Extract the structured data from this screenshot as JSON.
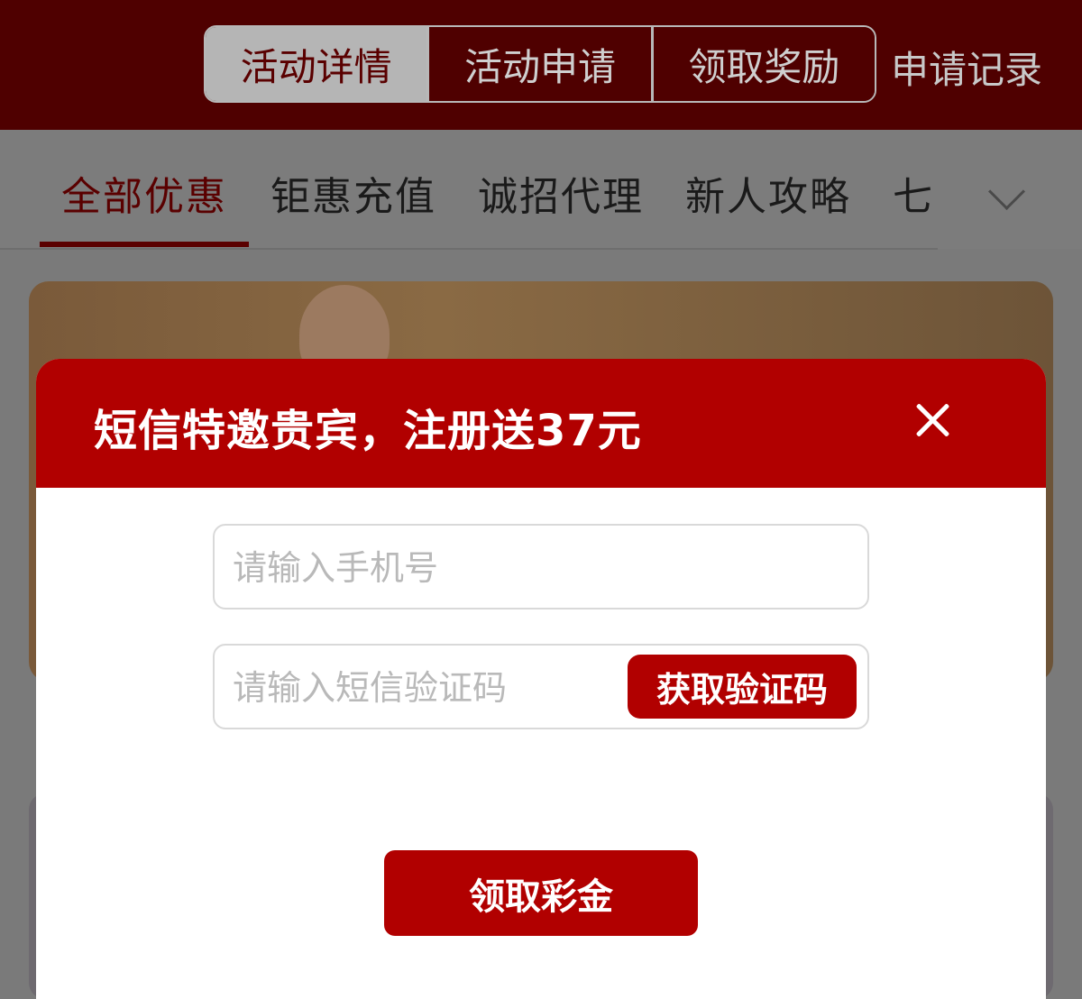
{
  "header": {
    "tabs": [
      {
        "label": "活动详情",
        "active": true
      },
      {
        "label": "活动申请",
        "active": false
      },
      {
        "label": "领取奖励",
        "active": false
      }
    ],
    "record_label": "申请记录"
  },
  "categories": {
    "items": [
      "全部优惠",
      "钜惠充值",
      "诚招代理",
      "新人攻略",
      "七"
    ],
    "active_index": 0,
    "expand_icon": "chevron-down-icon"
  },
  "modal": {
    "title": "短信特邀贵宾，注册送37元",
    "close_icon": "close-icon",
    "phone_placeholder": "请输入手机号",
    "code_placeholder": "请输入短信验证码",
    "get_code_label": "获取验证码",
    "submit_label": "领取彩金"
  },
  "colors": {
    "brand_red": "#b10000",
    "header_dark": "#4f0000",
    "overlay": "#7a7a7a"
  }
}
